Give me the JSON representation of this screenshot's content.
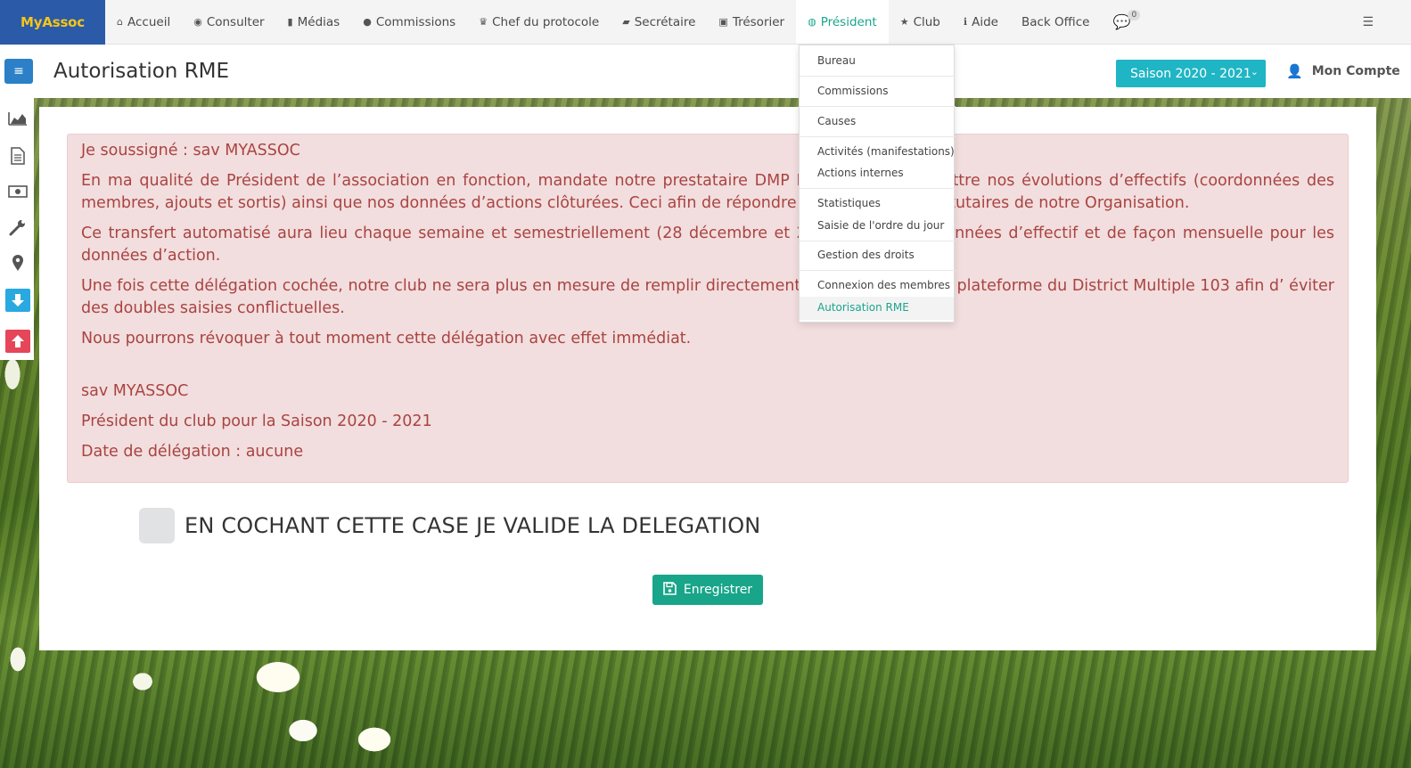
{
  "brand": "MyAssoc",
  "nav": {
    "items": [
      {
        "label": "Accueil",
        "icon": "home-icon",
        "glyph": "⌂"
      },
      {
        "label": "Consulter",
        "icon": "eye-icon",
        "glyph": "◉"
      },
      {
        "label": "Médias",
        "icon": "file-icon",
        "glyph": "▮"
      },
      {
        "label": "Commissions",
        "icon": "user-circle-icon",
        "glyph": "●"
      },
      {
        "label": "Chef du protocole",
        "icon": "trophy-icon",
        "glyph": "♛"
      },
      {
        "label": "Secrétaire",
        "icon": "book-icon",
        "glyph": "▰"
      },
      {
        "label": "Trésorier",
        "icon": "money-icon",
        "glyph": "▣"
      },
      {
        "label": "Président",
        "icon": "globe-icon",
        "glyph": "◍"
      },
      {
        "label": "Club",
        "icon": "star-icon",
        "glyph": "★"
      },
      {
        "label": "Aide",
        "icon": "info-icon",
        "glyph": "ℹ"
      },
      {
        "label": "Back Office",
        "icon": "",
        "glyph": ""
      }
    ],
    "chat_count": "0"
  },
  "page": {
    "title": "Autorisation RME",
    "season": "Saison 2020 - 2021",
    "account": "Mon Compte"
  },
  "alert": {
    "p1": "Je soussigné :  sav MYASSOC",
    "p2": "En ma qualité de Président de l’association en fonction, mandate notre prestataire DMP MyAssoc à transmettre nos évolutions d’effectifs (coordonnées des membres, ajouts et sortis) ainsi que nos données d’actions clôturées. Ceci afin de répondre aux obligations statutaires de notre Organisation.",
    "p3": "Ce transfert automatisé aura lieu chaque semaine et semestriellement (28 décembre et 28 juin) pour les données d’effectif et de façon mensuelle pour les données d’action.",
    "p4": "Une fois cette délégation cochée, notre club ne sera plus en mesure de remplir directement ces données sur la plateforme du District Multiple 103 afin d’ éviter des doubles saisies conflictuelles.",
    "p5": "Nous pourrons révoquer à tout moment cette délégation avec effet immédiat.",
    "p6": "sav MYASSOC",
    "p7": "Président du club pour la Saison 2020 - 2021",
    "p8": "Date de délégation : aucune"
  },
  "checkbox_label": "EN COCHANT CETTE CASE JE VALIDE LA DELEGATION",
  "save_label": "Enregistrer",
  "dropdown": {
    "bureau": "Bureau",
    "commissions": "Commissions",
    "causes": "Causes",
    "activites": "Activités (manifestations)",
    "actions_internes": "Actions internes",
    "statistiques": "Statistiques",
    "ordre_du_jour": "Saisie de l'ordre du jour",
    "gestion_droits": "Gestion des droits",
    "connexion_membres": "Connexion des membres",
    "autorisation_rme": "Autorisation RME"
  },
  "colors": {
    "brand_bg": "#2b5aa8",
    "brand_text": "#f5c518",
    "accent": "#1aa58e",
    "season_bg": "#1fb5c4",
    "alert_text": "#a94442",
    "alert_bg": "#f2dede"
  }
}
